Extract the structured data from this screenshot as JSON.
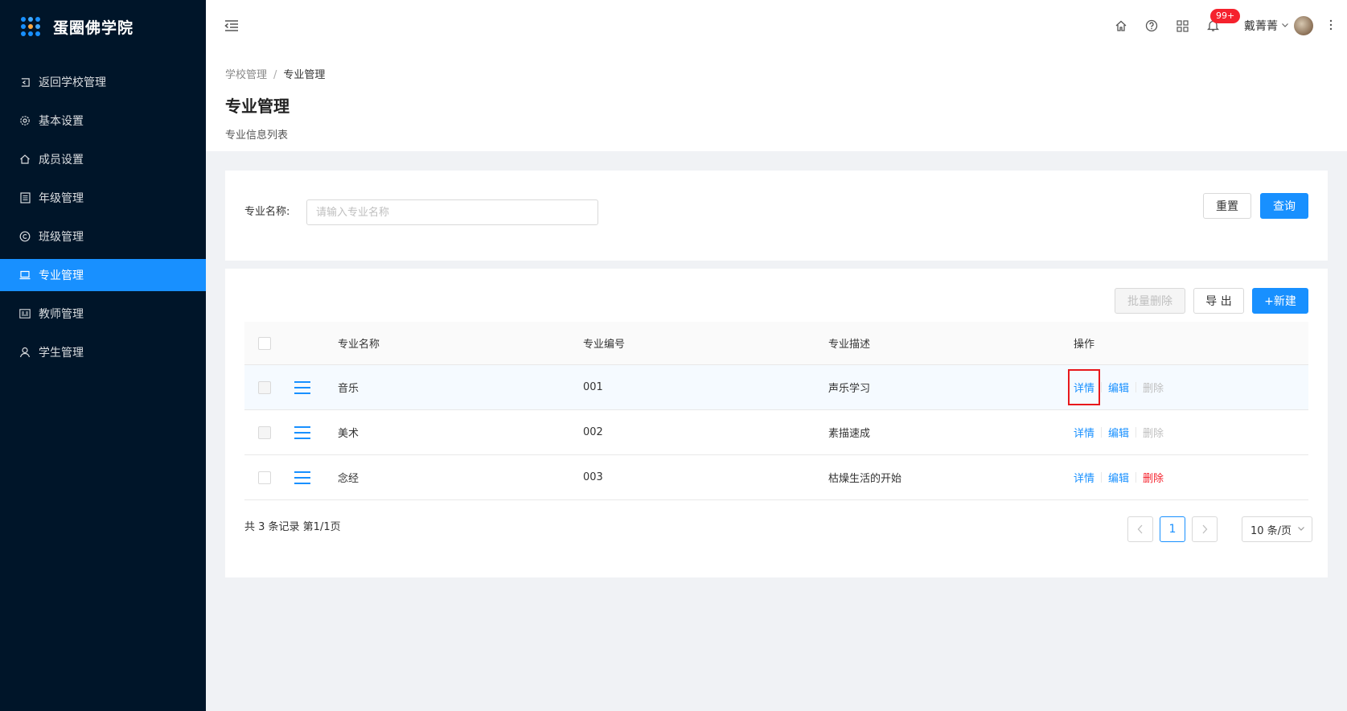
{
  "app": {
    "title": "蛋圈佛学院"
  },
  "sidebar": {
    "items": [
      {
        "label": "返回学校管理",
        "icon": "back-icon"
      },
      {
        "label": "基本设置",
        "icon": "gear-icon"
      },
      {
        "label": "成员设置",
        "icon": "home-icon"
      },
      {
        "label": "年级管理",
        "icon": "list-icon"
      },
      {
        "label": "班级管理",
        "icon": "copyright-icon"
      },
      {
        "label": "专业管理",
        "icon": "laptop-icon",
        "active": true
      },
      {
        "label": "教师管理",
        "icon": "idcard-icon"
      },
      {
        "label": "学生管理",
        "icon": "user-icon"
      }
    ]
  },
  "header": {
    "notification_count": "99+",
    "user_name": "戴菁菁"
  },
  "page": {
    "breadcrumb": [
      "学校管理",
      "专业管理"
    ],
    "title": "专业管理",
    "subtitle": "专业信息列表"
  },
  "search": {
    "label": "专业名称:",
    "placeholder": "请输入专业名称",
    "value": "",
    "reset_label": "重置",
    "query_label": "查询"
  },
  "toolbar": {
    "batch_delete_label": "批量删除",
    "export_label": "导 出",
    "new_label": "+新建"
  },
  "table": {
    "columns": [
      "专业名称",
      "专业编号",
      "专业描述",
      "操作"
    ],
    "rows": [
      {
        "name": "音乐",
        "code": "001",
        "desc": "声乐学习",
        "detail": "详情",
        "edit": "编辑",
        "delete": "删除"
      },
      {
        "name": "美术",
        "code": "002",
        "desc": "素描速成",
        "detail": "详情",
        "edit": "编辑",
        "delete": "删除"
      },
      {
        "name": "念经",
        "code": "003",
        "desc": "枯燥生活的开始",
        "detail": "详情",
        "edit": "编辑",
        "delete": "删除"
      }
    ]
  },
  "pagination": {
    "summary": "共 3 条记录 第1/1页",
    "current_page": "1",
    "page_size_label": "10 条/页"
  },
  "colors": {
    "primary": "#1890ff",
    "sidebar_bg": "#001529",
    "danger": "#f5222d",
    "highlight_box": "#e8181c"
  }
}
